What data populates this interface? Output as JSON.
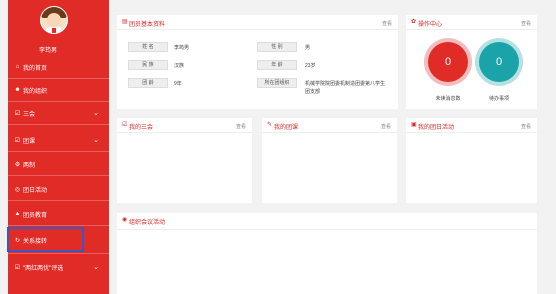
{
  "sidebar": {
    "username": "李筠男",
    "items": [
      {
        "label": "我的首页",
        "icon": "home-icon"
      },
      {
        "label": "我的组织",
        "icon": "users-icon"
      },
      {
        "label": "三会",
        "icon": "checkbox-icon"
      },
      {
        "label": "团课",
        "icon": "checkbox-icon"
      },
      {
        "label": "两制",
        "icon": "settings-icon"
      },
      {
        "label": "团日活动",
        "icon": "target-icon"
      },
      {
        "label": "团员教育",
        "icon": "graduation-cap-icon"
      },
      {
        "label": "关系接转",
        "icon": "refresh-icon"
      },
      {
        "label": "\"两红两优\"评选",
        "icon": "checkbox-icon"
      }
    ]
  },
  "info_panel": {
    "title": "团员基本资料",
    "link": "查看",
    "fields": [
      {
        "label": "姓 名",
        "value": "李筠男"
      },
      {
        "label": "性 别",
        "value": "男"
      },
      {
        "label": "民 族",
        "value": "汉族"
      },
      {
        "label": "年 龄",
        "value": "23岁"
      },
      {
        "label": "团 龄",
        "value": "9年"
      },
      {
        "label": "所在团组织",
        "value": "机械学院院团委机制造团委第八学生团支部"
      }
    ]
  },
  "ops_panel": {
    "title": "操作中心",
    "link": "查看",
    "unread_count": "0",
    "unread_label": "未读消息数",
    "todo_count": "0",
    "todo_label": "待办事项"
  },
  "panels": {
    "three_meetings": {
      "title": "我的三会",
      "link": "查看"
    },
    "my_course": {
      "title": "我的团课",
      "link": "查看"
    },
    "my_activity": {
      "title": "我的团日活动",
      "link": "查看"
    },
    "org_meeting": {
      "title": "组织会议活动"
    }
  },
  "colors": {
    "brand": "#e02b27",
    "teal": "#1aa3a8",
    "highlight": "#3a57c4"
  }
}
